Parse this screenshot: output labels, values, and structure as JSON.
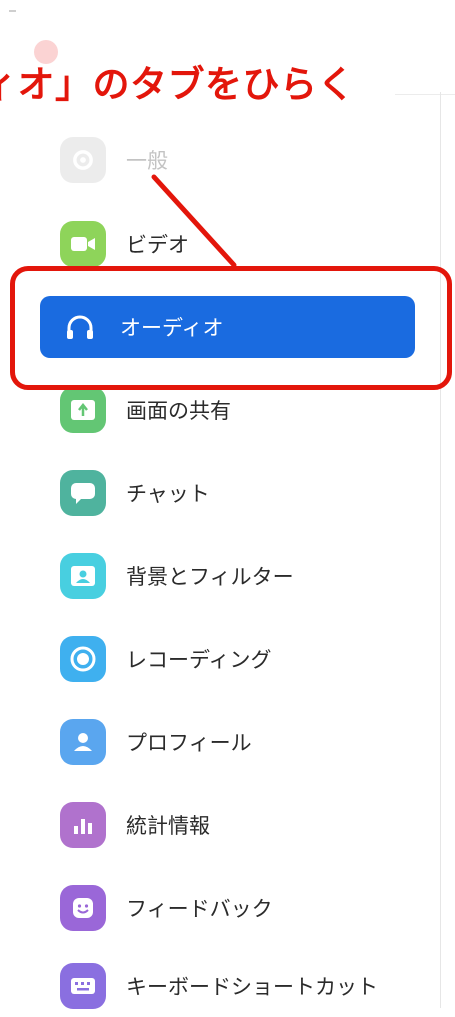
{
  "annotation": {
    "title": "ィオ」のタブをひらく"
  },
  "colors": {
    "annotation_red": "#e3160b",
    "active_blue": "#1a6be0"
  },
  "menu": {
    "active": "audio",
    "items": [
      {
        "id": "general",
        "label": "一般",
        "icon": "gear-icon",
        "color": "#bdbdbd"
      },
      {
        "id": "video",
        "label": "ビデオ",
        "icon": "video-camera-icon",
        "color": "#8ed45a"
      },
      {
        "id": "audio",
        "label": "オーディオ",
        "icon": "headphones-icon",
        "color": "#1a6be0"
      },
      {
        "id": "share",
        "label": "画面の共有",
        "icon": "share-screen-icon",
        "color": "#63c674"
      },
      {
        "id": "chat",
        "label": "チャット",
        "icon": "chat-bubble-icon",
        "color": "#4fb39e"
      },
      {
        "id": "background",
        "label": "背景とフィルター",
        "icon": "background-person-icon",
        "color": "#48cfe0"
      },
      {
        "id": "recording",
        "label": "レコーディング",
        "icon": "record-icon",
        "color": "#3fb0ef"
      },
      {
        "id": "profile",
        "label": "プロフィール",
        "icon": "profile-icon",
        "color": "#5aa6ef"
      },
      {
        "id": "statistics",
        "label": "統計情報",
        "icon": "bar-chart-icon",
        "color": "#b072cd"
      },
      {
        "id": "feedback",
        "label": "フィードバック",
        "icon": "smile-icon",
        "color": "#9a67d8"
      },
      {
        "id": "shortcuts",
        "label": "キーボードショートカット",
        "icon": "keyboard-icon",
        "color": "#8a6fe0"
      }
    ]
  }
}
